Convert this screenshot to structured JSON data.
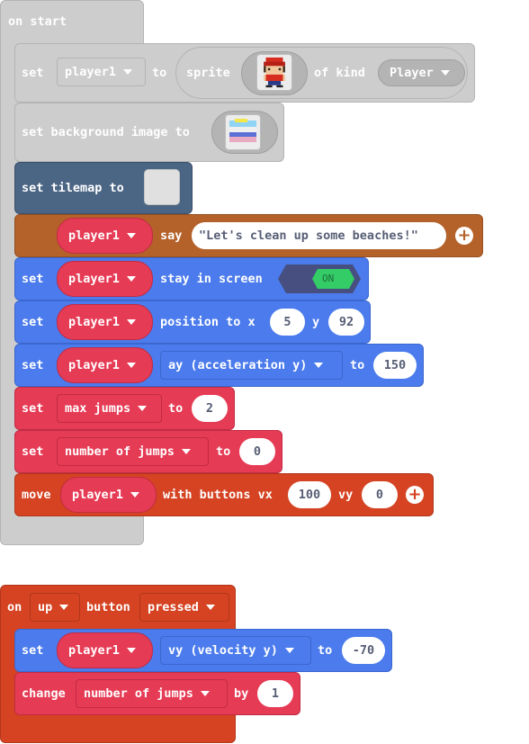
{
  "colors": {
    "gray_block": "#cdcdcd",
    "tilemap_block": "#4b6584",
    "say_block": "#b4622a",
    "sprite_block": "#4b7bec",
    "variable_block": "#e63b55",
    "controller_block": "#d54322",
    "toggle_on": "#33cc66"
  },
  "on_start": {
    "hat_label": "on start",
    "set_sprite": {
      "set_label": "set",
      "var_name": "player1",
      "to_label": "to",
      "sprite_label": "sprite",
      "sprite_image_icon": "character-sprite-icon",
      "of_kind_label": "of kind",
      "kind_value": "Player"
    },
    "set_background": {
      "label": "set background image to",
      "image_icon": "beach-image-icon"
    },
    "set_tilemap": {
      "label": "set tilemap to",
      "tilemap_icon": "empty-tilemap-icon"
    },
    "say": {
      "var_name": "player1",
      "say_label": "say",
      "text_value": "\"Let's clean up some beaches!\""
    },
    "stay_in_screen": {
      "set_label": "set",
      "var_name": "player1",
      "label": "stay in screen",
      "toggle_label": "ON"
    },
    "position": {
      "set_label": "set",
      "var_name": "player1",
      "label": "position to x",
      "x_value": "5",
      "y_label": "y",
      "y_value": "92"
    },
    "acceleration": {
      "set_label": "set",
      "var_name": "player1",
      "property": "ay (acceleration y)",
      "to_label": "to",
      "value": "150"
    },
    "max_jumps": {
      "set_label": "set",
      "var_name": "max jumps",
      "to_label": "to",
      "value": "2"
    },
    "number_of_jumps": {
      "set_label": "set",
      "var_name": "number of jumps",
      "to_label": "to",
      "value": "0"
    },
    "move": {
      "move_label": "move",
      "var_name": "player1",
      "label": "with buttons vx",
      "vx_value": "100",
      "vy_label": "vy",
      "vy_value": "0"
    }
  },
  "on_button": {
    "on_label": "on",
    "button_value": "up",
    "button_label": "button",
    "event_value": "pressed",
    "set_vy": {
      "set_label": "set",
      "var_name": "player1",
      "property": "vy (velocity y)",
      "to_label": "to",
      "value": "-70"
    },
    "change": {
      "change_label": "change",
      "var_name": "number of jumps",
      "by_label": "by",
      "value": "1"
    }
  }
}
